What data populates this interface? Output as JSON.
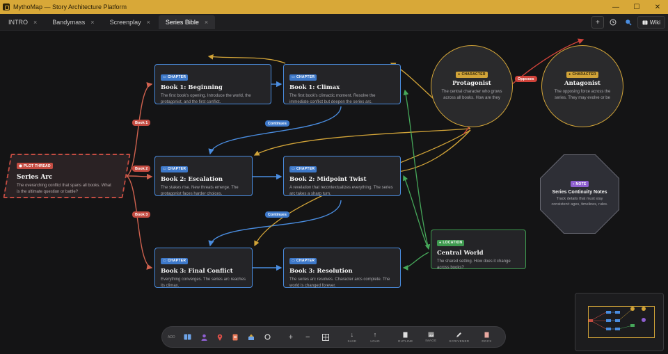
{
  "titlebar": {
    "title": "MythoMap — Story Architecture Platform",
    "minimize": "—",
    "maximize": "☐",
    "close": "✕"
  },
  "tabs": [
    {
      "label": "INTRO",
      "active": false
    },
    {
      "label": "Bandymass",
      "active": false
    },
    {
      "label": "Screenplay",
      "active": false
    },
    {
      "label": "Series Bible",
      "active": true
    }
  ],
  "tab_close_glyph": "×",
  "tab_actions": {
    "add": "+",
    "history": "◷",
    "search": "●",
    "wiki": "Wiki"
  },
  "nodes": {
    "plot_thread": {
      "badge": "PLOT THREAD",
      "title": "Series Arc",
      "desc": "The overarching conflict that spans all books. What is the ultimate question or battle?"
    },
    "b1_beginning": {
      "badge": "CHAPTER",
      "title": "Book 1: Beginning",
      "desc": "The first book's opening. Introduce the world, the protagonist, and the first conflict."
    },
    "b1_climax": {
      "badge": "CHAPTER",
      "title": "Book 1: Climax",
      "desc": "The first book's climactic moment. Resolve the immediate conflict but deepen the series arc."
    },
    "b2_escalation": {
      "badge": "CHAPTER",
      "title": "Book 2: Escalation",
      "desc": "The stakes rise. New threats emerge. The protagonist faces harder choices."
    },
    "b2_midpoint": {
      "badge": "CHAPTER",
      "title": "Book 2: Midpoint Twist",
      "desc": "A revelation that recontextualizes everything. The series arc takes a sharp turn."
    },
    "b3_final": {
      "badge": "CHAPTER",
      "title": "Book 3: Final Conflict",
      "desc": "Everything converges. The series arc reaches its climax."
    },
    "b3_resolution": {
      "badge": "CHAPTER",
      "title": "Book 3: Resolution",
      "desc": "The series arc resolves. Character arcs complete. The world is changed forever."
    },
    "protagonist": {
      "badge": "CHARACTER",
      "title": "Protagonist",
      "desc": "The central character who grows across all books. How are they"
    },
    "antagonist": {
      "badge": "CHARACTER",
      "title": "Antagonist",
      "desc": "The opposing force across the series. They may evolve or be"
    },
    "note": {
      "badge": "NOTE",
      "title": "Series Continuity Notes",
      "desc": "Track details that must stay consistent: ages, timelines, rules."
    },
    "location": {
      "badge": "LOCATION",
      "title": "Central World",
      "desc": "The shared setting. How does it change across books?"
    }
  },
  "edge_labels": {
    "book1": "Book 1",
    "book2": "Book 2",
    "book3": "Book 3",
    "continues_1": "Continues",
    "continues_2": "Continues",
    "opposes": "Opposes"
  },
  "toolbar": {
    "add": "ADD",
    "zoom_in": "+",
    "zoom_out": "−",
    "save": "SAVE",
    "load": "LOAD",
    "outline": "OUTLINE",
    "image": "IMAGE",
    "scrivener": "SCRIVENER",
    "docx": "DOCX"
  },
  "colors": {
    "titlebar": "#d8a838",
    "chapter": "#4a8de0",
    "character": "#d2a438",
    "location": "#3e9a4f",
    "plot": "#c44c42",
    "note": "#8e5fd0"
  }
}
